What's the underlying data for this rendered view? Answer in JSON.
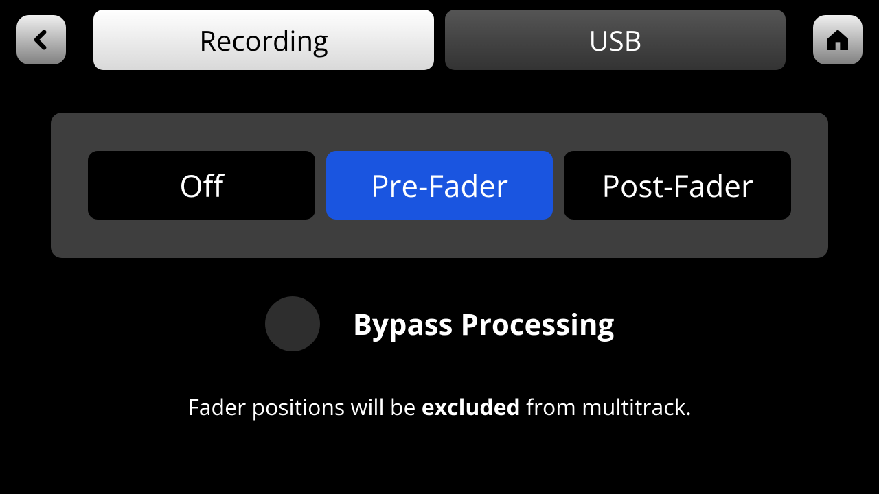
{
  "tabs": [
    {
      "label": "Recording",
      "active": true
    },
    {
      "label": "USB",
      "active": false
    }
  ],
  "options": [
    {
      "label": "Off",
      "selected": false
    },
    {
      "label": "Pre-Fader",
      "selected": true
    },
    {
      "label": "Post-Fader",
      "selected": false
    }
  ],
  "bypass": {
    "label": "Bypass Processing",
    "checked": false
  },
  "hint": {
    "before": "Fader positions will be ",
    "bold": "excluded",
    "after": " from multitrack."
  },
  "icons": {
    "back": "chevron-left-icon",
    "home": "home-icon"
  }
}
